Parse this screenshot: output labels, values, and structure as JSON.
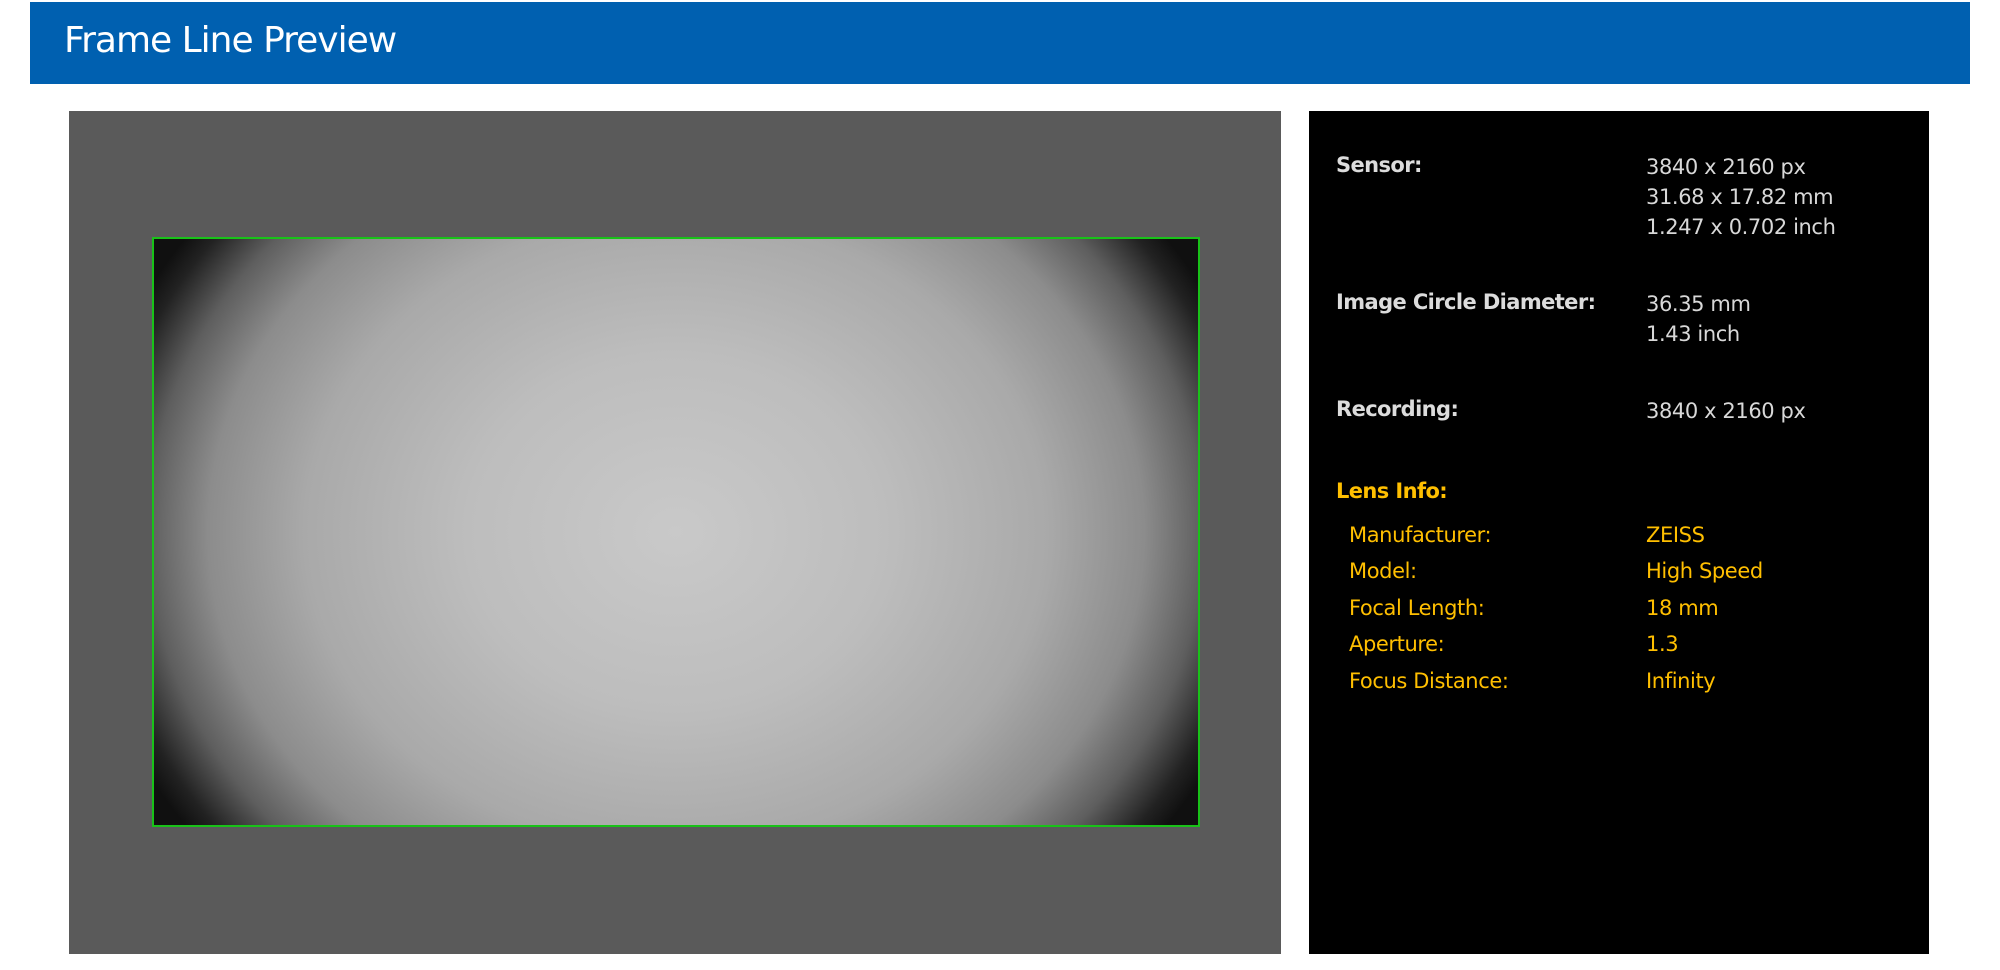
{
  "header": {
    "title": "Frame Line Preview"
  },
  "colors": {
    "header_bg": "#0060b0",
    "frame_line": "#19c219",
    "lens_info_accent": "#ffbf00",
    "panel_bg": "#000000",
    "viewer_bg": "#5a5a5a"
  },
  "info": {
    "sensor": {
      "label": "Sensor:",
      "values": [
        "3840 x 2160 px",
        "31.68 x 17.82 mm",
        "1.247 x 0.702 inch"
      ]
    },
    "image_circle": {
      "label": "Image Circle Diameter:",
      "values": [
        "36.35 mm",
        "1.43 inch"
      ]
    },
    "recording": {
      "label": "Recording:",
      "values": [
        "3840 x 2160 px"
      ]
    },
    "lens_info": {
      "title": "Lens Info:",
      "rows": [
        {
          "label": "Manufacturer:",
          "value": "ZEISS"
        },
        {
          "label": "Model:",
          "value": "High Speed"
        },
        {
          "label": "Focal Length:",
          "value": "18 mm"
        },
        {
          "label": "Aperture:",
          "value": "1.3"
        },
        {
          "label": "Focus Distance:",
          "value": "Infinity"
        }
      ]
    }
  }
}
